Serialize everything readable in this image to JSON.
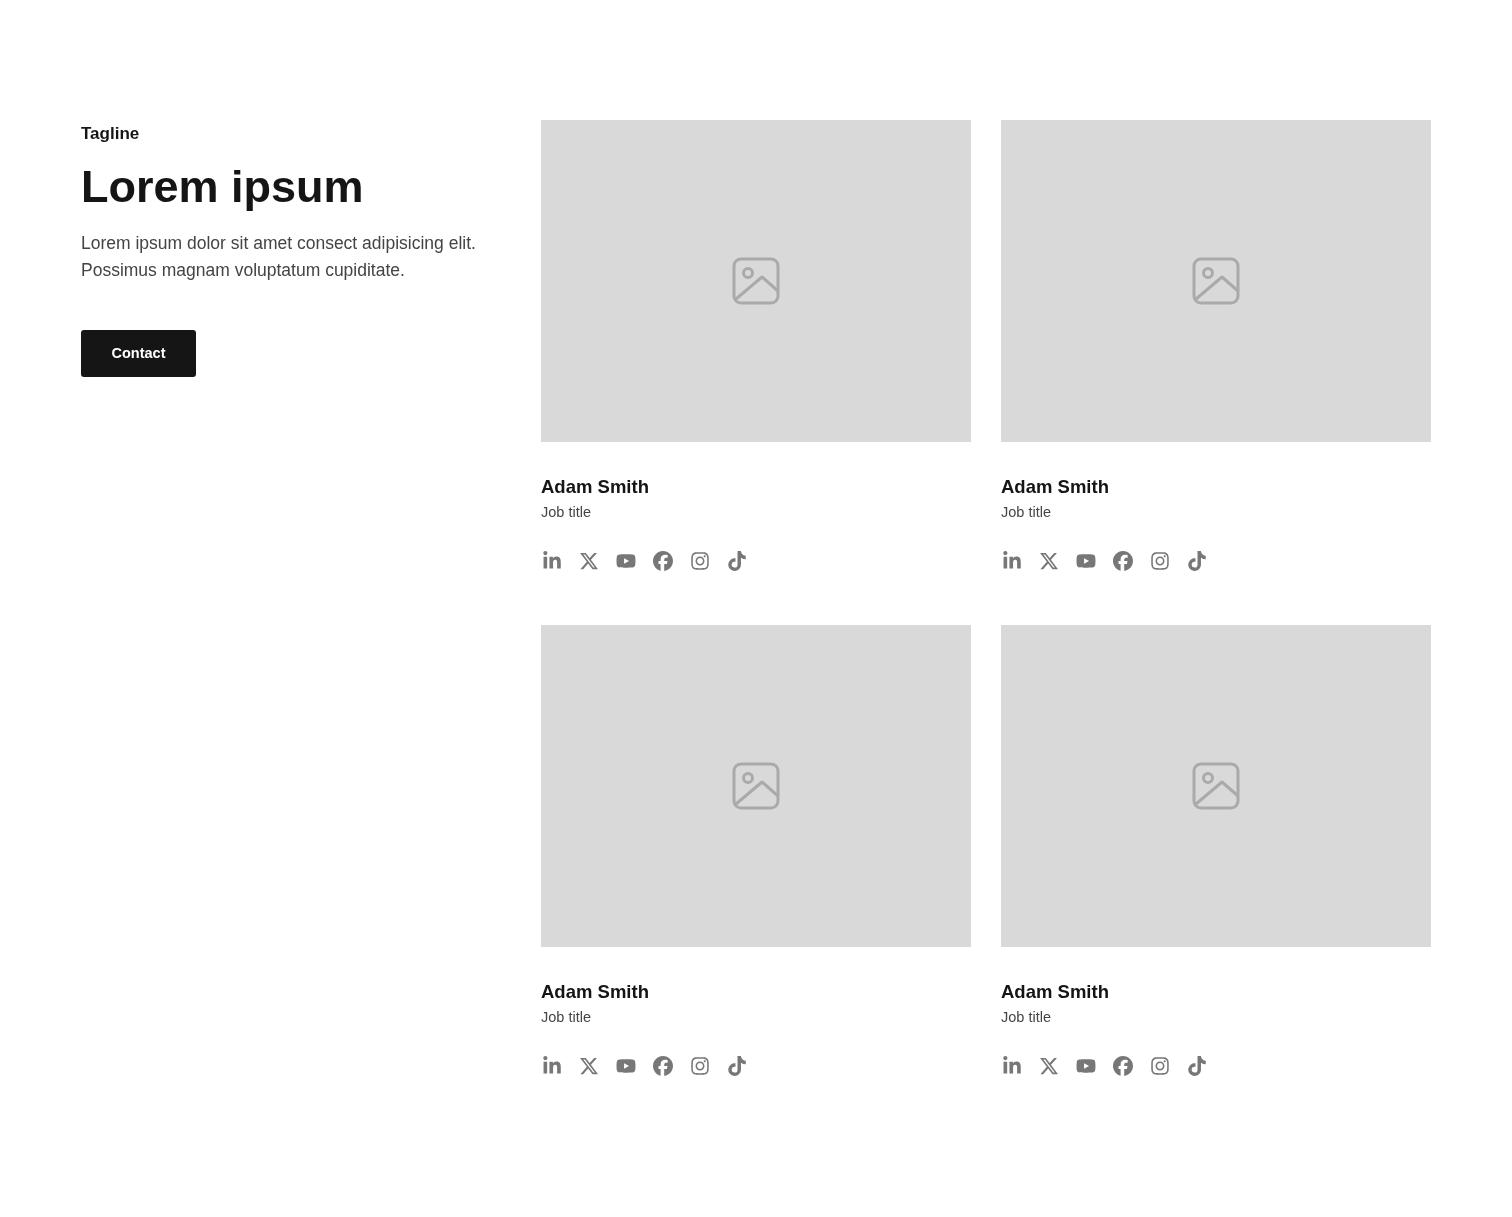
{
  "intro": {
    "tagline": "Tagline",
    "heading": "Lorem ipsum",
    "description": "Lorem ipsum dolor sit amet consect adipisicing elit. Possimus magnam voluptatum cupiditate.",
    "button": "Contact"
  },
  "members": [
    {
      "name": "Adam Smith",
      "job_title": "Job title"
    },
    {
      "name": "Adam Smith",
      "job_title": "Job title"
    },
    {
      "name": "Adam Smith",
      "job_title": "Job title"
    },
    {
      "name": "Adam Smith",
      "job_title": "Job title"
    }
  ]
}
